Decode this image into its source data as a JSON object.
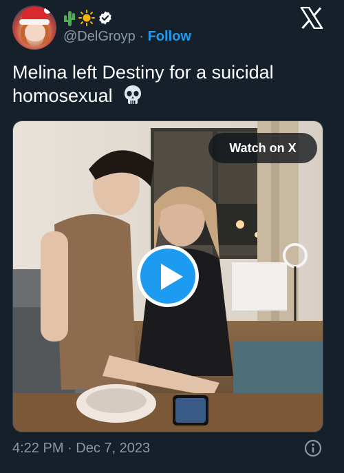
{
  "author": {
    "handle": "@DelGroyp",
    "separator": " · ",
    "follow_label": "Follow",
    "verified": true,
    "emoji_icons": [
      "cactus-icon",
      "sun-icon",
      "verified-badge-icon"
    ]
  },
  "brand": {
    "icon": "x-logo-icon"
  },
  "tweet": {
    "text": "Melina left Destiny for a suicidal homosexual",
    "emoji_icon": "skull-icon"
  },
  "media": {
    "type": "video",
    "watch_label": "Watch on X",
    "play_icon": "play-icon"
  },
  "footer": {
    "timestamp": "4:22 PM · Dec 7, 2023",
    "info_icon": "info-icon"
  },
  "colors": {
    "background": "#15202b",
    "accent": "#1d9bf0",
    "muted": "#8b98a5"
  }
}
